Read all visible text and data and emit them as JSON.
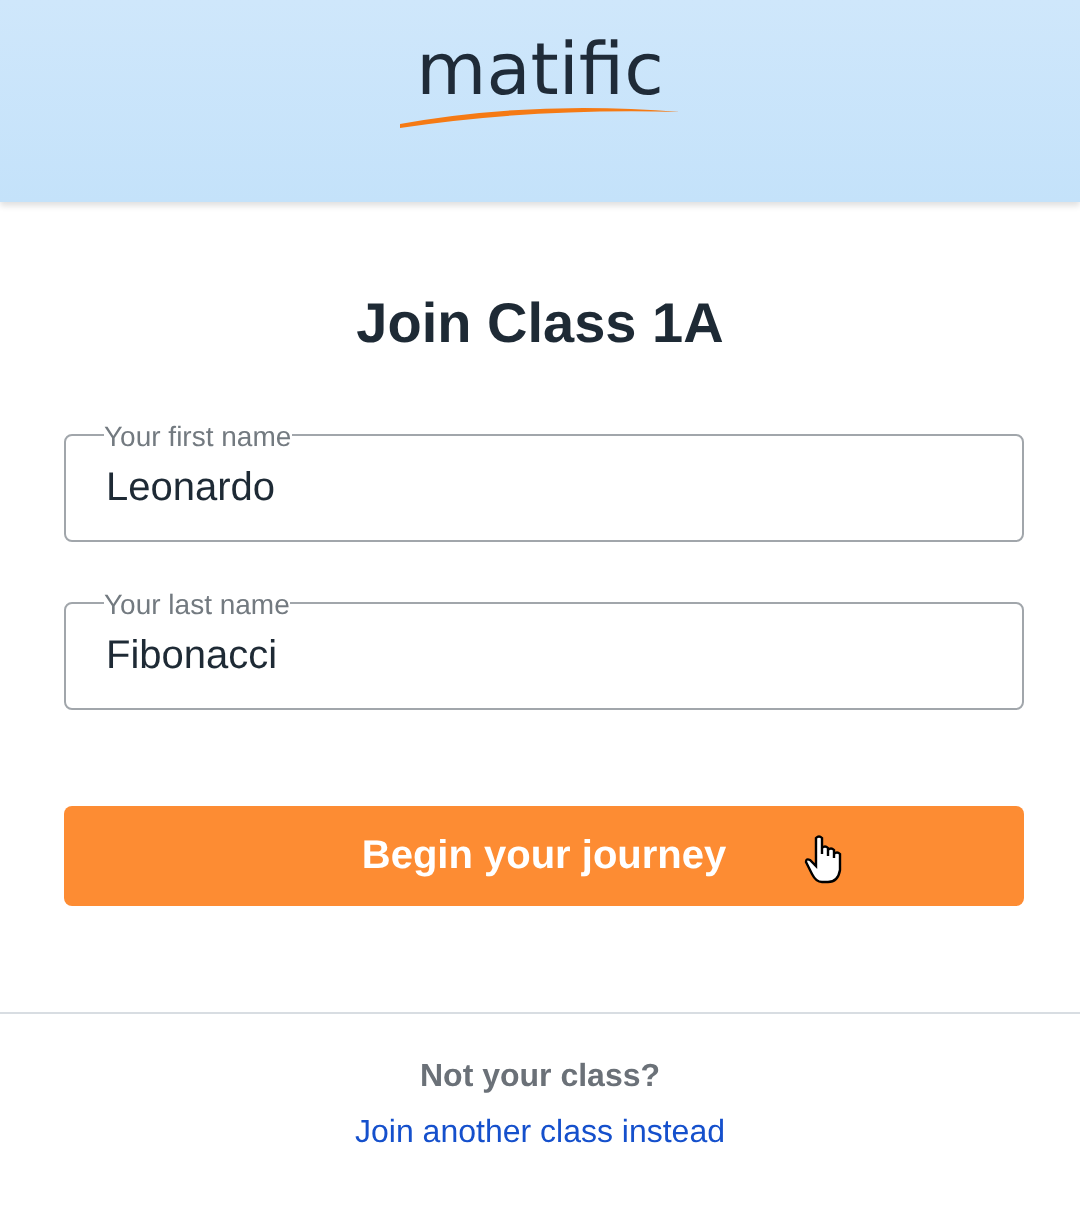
{
  "logo": {
    "text": "matific"
  },
  "title": "Join Class 1A",
  "fields": [
    {
      "label": "Your first name",
      "value": "Leonardo"
    },
    {
      "label": "Your last name",
      "value": "Fibonacci"
    }
  ],
  "submit_button": {
    "label": "Begin your journey"
  },
  "footer": {
    "question": "Not your class?",
    "link": "Join another class instead"
  }
}
